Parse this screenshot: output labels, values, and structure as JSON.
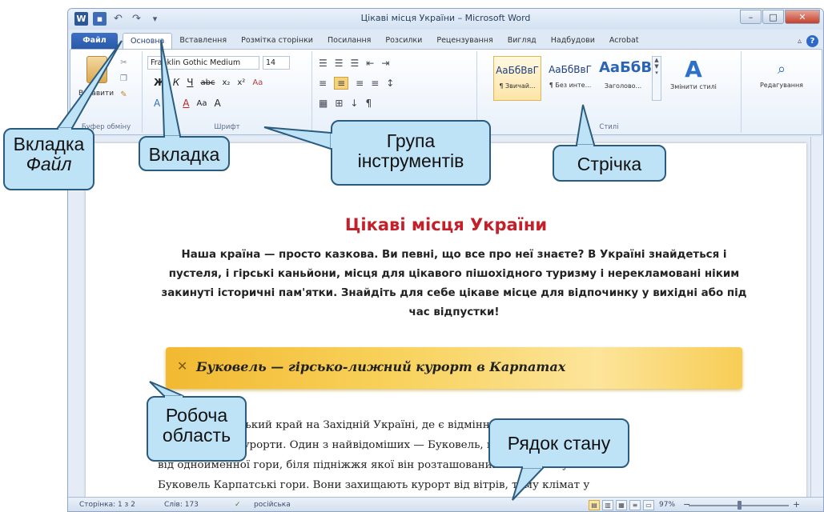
{
  "window": {
    "title": "Цікаві місця України – Microsoft Word"
  },
  "qat": {
    "word_logo": "W",
    "undo": "↶",
    "redo": "↷",
    "customize": "▾"
  },
  "wincontrols": {
    "minimize": "–",
    "maximize": "□",
    "close": "✕"
  },
  "tabs": [
    "Файл",
    "Основна",
    "Вставлення",
    "Розмітка сторінки",
    "Посилання",
    "Розсилки",
    "Рецензування",
    "Вигляд",
    "Надбудови",
    "Acrobat"
  ],
  "help": {
    "caret": "▵",
    "help": "?"
  },
  "ribbon": {
    "clipboard": {
      "paste_label": "Вставити",
      "group_label": "Буфер обміну"
    },
    "font": {
      "font_name": "Franklin Gothic Medium",
      "font_size": "14",
      "group_label": "Шрифт",
      "row2": [
        "Ж",
        "К",
        "Ч",
        "abc",
        "x₂",
        "x²",
        "Aa"
      ],
      "row3": [
        "A",
        "Aa",
        "A",
        "A"
      ]
    },
    "paragraph": {
      "row1": [
        "☰",
        "☰",
        "☰",
        "⇤",
        "⇥"
      ],
      "row2": [
        "≡",
        "≡",
        "≡",
        "≡",
        "↕"
      ],
      "row3": [
        "▦",
        "⊞",
        "↓",
        "¶"
      ]
    },
    "styles": {
      "group_label": "Стилі",
      "items": [
        {
          "sample": "АаБбВвГ",
          "name": "¶ Звичай..."
        },
        {
          "sample": "АаБбВвГ",
          "name": "¶ Без инте..."
        },
        {
          "sample": "АаБбВ",
          "name": "Заголово..."
        }
      ],
      "change_label": "Змінити стилі",
      "change_glyph": "A"
    },
    "editing": {
      "label": "Редагування",
      "glyph": "⌕"
    }
  },
  "document": {
    "title": "Цікаві місця України",
    "intro": "Наша країна — просто казкова. Ви певні, що все про неї знаєте? В Україні знайдеться і пустеля, і гірські каньйони, місця для цікавого пішохідного туризму і нерекламовані ніким закинуті історичні пам'ятки. Знайдіть для себе цікаве місце для відпочинку у вихідні або під час відпустки!",
    "banner_mark": "✕",
    "banner": "Буковель — гірсько-лижний курорт в Карпатах",
    "body_lines": [
      "Карпати — гірський край на Західній Україні, де є відмінні",
      "гірськолижні курорти. Один з найвідоміших — Буковель, що отримав свою назву",
      "від однойменної гори, біля підніжжя якої він розташований. Його обступили",
      "Буковель Карпатські гори. Вони захищають курорт від вітрів, тому клімат у"
    ]
  },
  "statusbar": {
    "page": "Сторінка: 1 з 2",
    "words": "Слів: 173",
    "proof": "✓",
    "language": "російська",
    "zoom": "97%",
    "zoom_minus": "−",
    "zoom_plus": "+",
    "zoom_level": 0.5
  },
  "callouts": {
    "file_line1": "Вкладка",
    "file_line2": "Файл",
    "tab": "Вкладка",
    "group_line1": "Група",
    "group_line2": "інструментів",
    "ribbon": "Стрічка",
    "work_line1": "Робоча",
    "work_line2": "область",
    "status": "Рядок стану"
  }
}
